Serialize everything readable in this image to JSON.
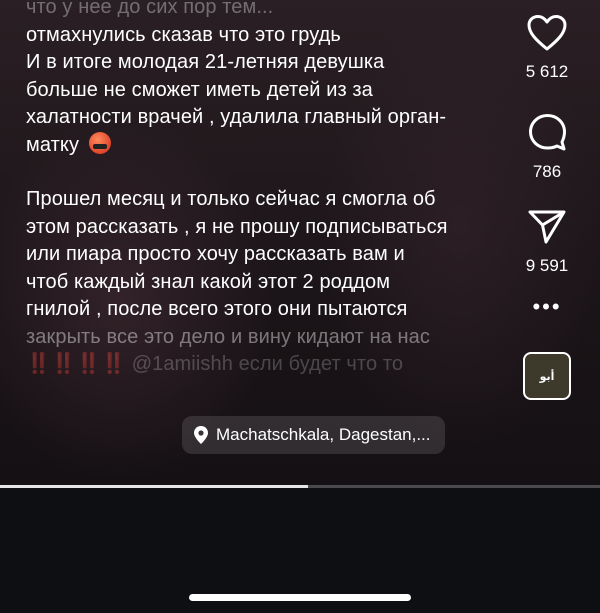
{
  "caption": {
    "line_top": "что у нее до сих пор тем...",
    "line_1": "отмахнулись сказав что это грудь",
    "line_2": "И в итоге молодая 21-летняя девушка",
    "line_3": "больше не сможет иметь детей из за",
    "line_4": "халатности врачей , удалила главный орган-",
    "line_5": "матку",
    "emoji": "angry-face-emoji",
    "line_6": "Прошел месяц и только сейчас я смогла об",
    "line_7": "этом рассказать , я не прошу подписываться",
    "line_8": "или пиара  просто хочу рассказать вам и",
    "line_9": "чтоб каждый знал какой этот 2 роддом",
    "line_10": "гнилой , после всего этого они пытаются",
    "line_11": "закрыть все это дело и вину кидают на нас",
    "line_12_bangs": "‼️‼️‼️‼️",
    "line_12": "@1amiishh если будет что то"
  },
  "actions": {
    "like_icon": "heart-icon",
    "like_count": "5 612",
    "comment_icon": "comment-bubble-icon",
    "comment_count": "786",
    "share_icon": "paper-plane-icon",
    "share_count": "9 591",
    "more_icon": "more-dots-icon",
    "audio_label": "أبو"
  },
  "location": {
    "icon": "location-pin-icon",
    "text": "Machatschkala, Dagestan,..."
  },
  "progress": {
    "fraction": 0.513
  },
  "colors": {
    "background": "#0e0f12",
    "text": "#ffffff"
  }
}
